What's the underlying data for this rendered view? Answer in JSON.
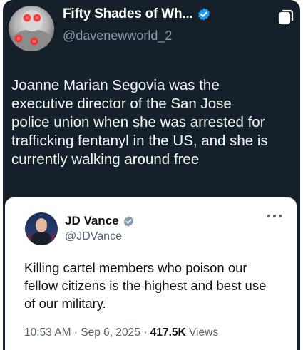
{
  "tweet": {
    "display_name": "Fifty Shades of Wh...",
    "handle": "@davenewworld_2",
    "text_lines": [
      "Joanne Marian Segovia was the",
      "executive director of the San Jose",
      "police union when she was arrested for",
      "trafficking fentanyl in the US, and she is",
      "currently walking around free"
    ]
  },
  "quoted_tweet": {
    "display_name": "JD Vance",
    "handle": "@JDVance",
    "text_lines": [
      "Killing cartel members who poison our",
      "fellow citizens is the highest and best use",
      "of our military."
    ],
    "time": "10:53 AM",
    "separator": "·",
    "date": "Sep 6, 2025",
    "views_count": "417.5K",
    "views_label": "Views"
  },
  "colors": {
    "background": "#15202b",
    "verified_blue": "#1d9bf0",
    "secondary_text": "#8b98a5"
  },
  "icons": [
    "verified-badge-icon",
    "copy-icon",
    "more-options-icon"
  ]
}
